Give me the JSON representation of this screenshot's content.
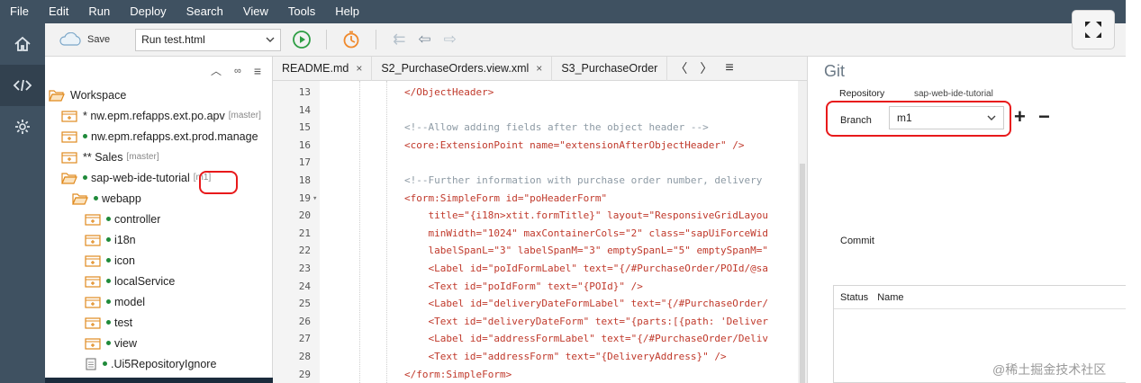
{
  "menu": [
    "File",
    "Edit",
    "Run",
    "Deploy",
    "Search",
    "View",
    "Tools",
    "Help"
  ],
  "toolbar": {
    "save_label": "Save",
    "run_config": "Run test.html"
  },
  "tree": {
    "items": [
      {
        "label": "Workspace",
        "tag": "",
        "dot": false,
        "indent": 0,
        "icon": "folder-open"
      },
      {
        "label": "* nw.epm.refapps.ext.po.apv",
        "tag": "[master]",
        "dot": false,
        "indent": 1,
        "icon": "project"
      },
      {
        "label": "nw.epm.refapps.ext.prod.manage",
        "tag": "",
        "dot": true,
        "indent": 1,
        "icon": "project"
      },
      {
        "label": "** Sales",
        "tag": "[master]",
        "dot": false,
        "indent": 1,
        "icon": "project"
      },
      {
        "label": "sap-web-ide-tutorial",
        "tag": "[m1]",
        "dot": true,
        "indent": 1,
        "icon": "folder-open"
      },
      {
        "label": "webapp",
        "tag": "",
        "dot": true,
        "indent": 2,
        "icon": "folder-open"
      },
      {
        "label": "controller",
        "tag": "",
        "dot": true,
        "indent": 3,
        "icon": "folder-plus"
      },
      {
        "label": "i18n",
        "tag": "",
        "dot": true,
        "indent": 3,
        "icon": "folder-plus"
      },
      {
        "label": "icon",
        "tag": "",
        "dot": true,
        "indent": 3,
        "icon": "folder-plus"
      },
      {
        "label": "localService",
        "tag": "",
        "dot": true,
        "indent": 3,
        "icon": "folder-plus"
      },
      {
        "label": "model",
        "tag": "",
        "dot": true,
        "indent": 3,
        "icon": "folder-plus"
      },
      {
        "label": "test",
        "tag": "",
        "dot": true,
        "indent": 3,
        "icon": "folder-plus"
      },
      {
        "label": "view",
        "tag": "",
        "dot": true,
        "indent": 3,
        "icon": "folder-plus"
      },
      {
        "label": ".Ui5RepositoryIgnore",
        "tag": "",
        "dot": true,
        "indent": 3,
        "icon": "file"
      }
    ]
  },
  "editor": {
    "tabs": [
      {
        "label": "README.md",
        "close": "×"
      },
      {
        "label": "S2_PurchaseOrders.view.xml",
        "close": "×"
      },
      {
        "label": "S3_PurchaseOrder",
        "close": ""
      }
    ],
    "lines": [
      {
        "n": "13",
        "fold": "",
        "text": "</ObjectHeader>",
        "kind": "tag"
      },
      {
        "n": "14",
        "fold": "",
        "text": "",
        "kind": "tag"
      },
      {
        "n": "15",
        "fold": "",
        "text": "<!--Allow adding fields after the object header -->",
        "kind": "comment"
      },
      {
        "n": "16",
        "fold": "",
        "text": "<core:ExtensionPoint name=\"extensionAfterObjectHeader\" />",
        "kind": "tag"
      },
      {
        "n": "17",
        "fold": "",
        "text": "",
        "kind": "tag"
      },
      {
        "n": "18",
        "fold": "",
        "text": "<!--Further information with purchase order number, delivery",
        "kind": "comment"
      },
      {
        "n": "19",
        "fold": "▾",
        "text": "<form:SimpleForm id=\"poHeaderForm\"",
        "kind": "tag"
      },
      {
        "n": "20",
        "fold": "",
        "text": "    title=\"{i18n>xtit.formTitle}\" layout=\"ResponsiveGridLayou",
        "kind": "tag"
      },
      {
        "n": "21",
        "fold": "",
        "text": "    minWidth=\"1024\" maxContainerCols=\"2\" class=\"sapUiForceWid",
        "kind": "tag"
      },
      {
        "n": "22",
        "fold": "",
        "text": "    labelSpanL=\"3\" labelSpanM=\"3\" emptySpanL=\"5\" emptySpanM=\"",
        "kind": "tag"
      },
      {
        "n": "23",
        "fold": "",
        "text": "    <Label id=\"poIdFormLabel\" text=\"{/#PurchaseOrder/POId/@sa",
        "kind": "tag"
      },
      {
        "n": "24",
        "fold": "",
        "text": "    <Text id=\"poIdForm\" text=\"{POId}\" />",
        "kind": "tag"
      },
      {
        "n": "25",
        "fold": "",
        "text": "    <Label id=\"deliveryDateFormLabel\" text=\"{/#PurchaseOrder/",
        "kind": "tag"
      },
      {
        "n": "26",
        "fold": "",
        "text": "    <Text id=\"deliveryDateForm\" text=\"{parts:[{path: 'Deliver",
        "kind": "tag"
      },
      {
        "n": "27",
        "fold": "",
        "text": "    <Label id=\"addressFormLabel\" text=\"{/#PurchaseOrder/Deliv",
        "kind": "tag"
      },
      {
        "n": "28",
        "fold": "",
        "text": "    <Text id=\"addressForm\" text=\"{DeliveryAddress}\" />",
        "kind": "tag"
      },
      {
        "n": "29",
        "fold": "",
        "text": "</form:SimpleForm>",
        "kind": "tag"
      }
    ]
  },
  "git": {
    "title": "Git",
    "repository_label": "Repository",
    "repository_value": "sap-web-ide-tutorial",
    "branch_label": "Branch",
    "branch_value": "m1",
    "add_label": "+",
    "remove_label": "−",
    "commit_label": "Commit",
    "status_col": "Status",
    "name_col": "Name"
  },
  "watermark": "@稀土掘金技术社区",
  "colors": {
    "menubar": "#3f5161",
    "highlight": "#e8191b",
    "tag_code": "#c0392b",
    "comment_code": "#8d9aa4"
  }
}
